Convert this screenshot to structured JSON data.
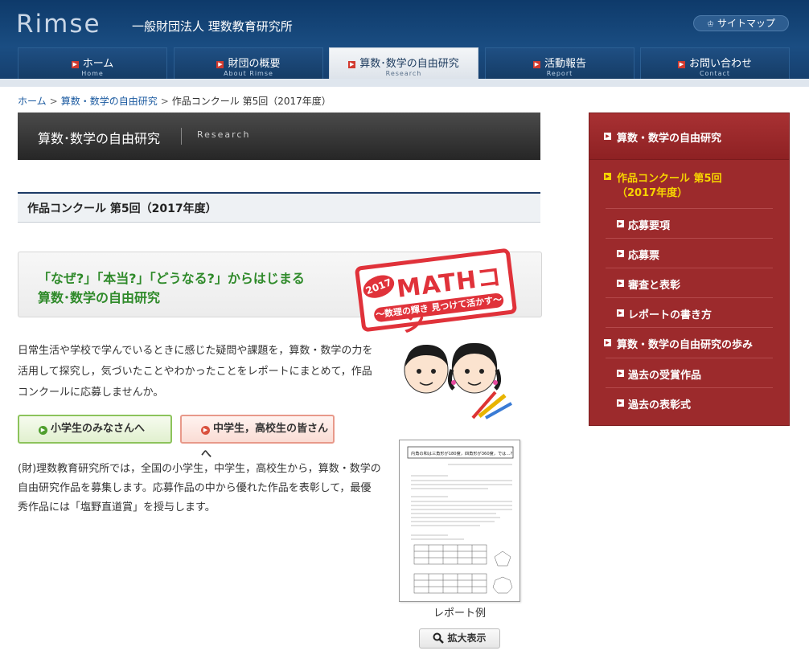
{
  "header": {
    "logo": "Rimse",
    "org_name": "一般財団法人 理数教育研究所",
    "sitemap": "サイトマップ"
  },
  "nav": [
    {
      "label": "ホーム",
      "sub": "Home"
    },
    {
      "label": "財団の概要",
      "sub": "About Rimse"
    },
    {
      "label": "算数･数学の自由研究",
      "sub": "Research"
    },
    {
      "label": "活動報告",
      "sub": "Report"
    },
    {
      "label": "お問い合わせ",
      "sub": "Contact"
    }
  ],
  "breadcrumb": {
    "home": "ホーム",
    "section": "算数・数学の自由研究",
    "current": "作品コンクール 第5回（2017年度）",
    "sep": ">"
  },
  "banner": {
    "title": "算数･数学の自由研究",
    "sub": "Research"
  },
  "page_heading": "作品コンクール 第5回（2017年度）",
  "promo": {
    "line1": "「なぜ?」「本当?」「どうなる?」からはじまる",
    "line2": "算数･数学の自由研究",
    "year": "2017",
    "logo_main": "MATHコン",
    "logo_sub": "〜数理の輝き 見つけて活かす〜"
  },
  "intro": "日常生活や学校で学んでいるときに感じた疑問や課題を，算数・数学の力を活用して探究し，気づいたことやわかったことをレポートにまとめて，作品コンクールに応募しませんか。",
  "buttons": {
    "elementary": "小学生のみなさんへ",
    "secondary": "中学生，高校生の皆さんへ"
  },
  "body2": "(財)理数教育研究所では，全国の小学生，中学生，高校生から，算数・数学の自由研究作品を募集します。応募作品の中から優れた作品を表彰して，最優秀作品には「塩野直道賞」を授与します。",
  "report": {
    "caption": "レポート例",
    "zoom": "拡大表示",
    "doc_title": "内角の和は三角形が180度，四角形が360度，では…?"
  },
  "sidebar": {
    "head": "算数・数学の自由研究",
    "items": [
      {
        "label": "作品コンクール 第5回",
        "label2": "（2017年度）"
      },
      {
        "label": "応募要項"
      },
      {
        "label": "応募票"
      },
      {
        "label": "審査と表彰"
      },
      {
        "label": "レポートの書き方"
      },
      {
        "label": "算数・数学の自由研究の歩み"
      },
      {
        "label": "過去の受賞作品"
      },
      {
        "label": "過去の表彰式"
      }
    ]
  },
  "colors": {
    "header": "#1a4d82",
    "sidebar": "#9c2a2c",
    "promo_green": "#2f8a2a",
    "mathcon_red": "#e0323a"
  }
}
